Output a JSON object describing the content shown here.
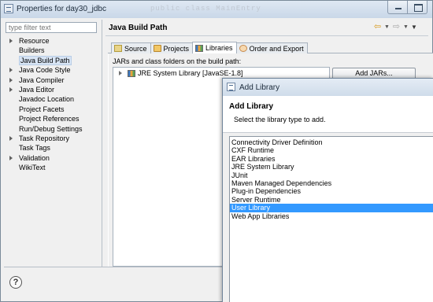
{
  "window": {
    "title": "Properties for day30_jdbc",
    "background_code": "public class MainEntry"
  },
  "filter": {
    "placeholder": "type filter text"
  },
  "nav_tree": [
    {
      "label": "Resource",
      "expandable": true
    },
    {
      "label": "Builders",
      "expandable": false
    },
    {
      "label": "Java Build Path",
      "expandable": false,
      "selected": true
    },
    {
      "label": "Java Code Style",
      "expandable": true
    },
    {
      "label": "Java Compiler",
      "expandable": true
    },
    {
      "label": "Java Editor",
      "expandable": true
    },
    {
      "label": "Javadoc Location",
      "expandable": false
    },
    {
      "label": "Project Facets",
      "expandable": false
    },
    {
      "label": "Project References",
      "expandable": false
    },
    {
      "label": "Run/Debug Settings",
      "expandable": false
    },
    {
      "label": "Task Repository",
      "expandable": true
    },
    {
      "label": "Task Tags",
      "expandable": false
    },
    {
      "label": "Validation",
      "expandable": true
    },
    {
      "label": "WikiText",
      "expandable": false
    }
  ],
  "page": {
    "title": "Java Build Path"
  },
  "tabs": [
    {
      "label": "Source",
      "icon": "source-folder-icon"
    },
    {
      "label": "Projects",
      "icon": "projects-icon"
    },
    {
      "label": "Libraries",
      "icon": "libraries-icon",
      "active": true
    },
    {
      "label": "Order and Export",
      "icon": "order-export-icon"
    }
  ],
  "libraries": {
    "label": "JARs and class folders on the build path:",
    "items": [
      "JRE System Library [JavaSE-1.8]"
    ],
    "add_jars": "Add JARs..."
  },
  "dialog": {
    "title": "Add Library",
    "heading": "Add Library",
    "description": "Select the library type to add.",
    "types": [
      "Connectivity Driver Definition",
      "CXF Runtime",
      "EAR Libraries",
      "JRE System Library",
      "JUnit",
      "Maven Managed Dependencies",
      "Plug-in Dependencies",
      "Server Runtime",
      "User Library",
      "Web App Libraries"
    ],
    "selected": "User Library"
  },
  "colors": {
    "selection": "#3399ff",
    "tree_selection": "#d7e4f4"
  }
}
